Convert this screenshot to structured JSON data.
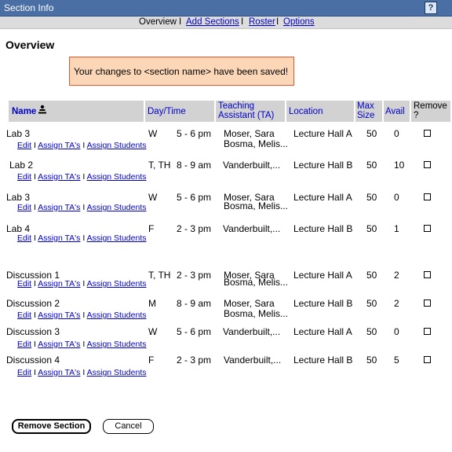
{
  "window": {
    "title": "Section Info",
    "help_icon": "help-icon"
  },
  "subnav": {
    "current": "Overview",
    "links": [
      "Add Sections",
      "Roster",
      "Options"
    ],
    "separator": "I"
  },
  "page": {
    "heading": "Overview"
  },
  "notice": {
    "text": "Your changes to <section name> have been saved!"
  },
  "table": {
    "headers": {
      "name": "Name",
      "sort_icon": "sort-ascending-icon",
      "daytime": "Day/Time",
      "ta_line1": "Teaching",
      "ta_line2": "Assistant (TA)",
      "location": "Location",
      "max_line1": "Max",
      "max_line2": "Size",
      "avail": "Avail",
      "remove_line1": "Remove",
      "remove_line2": "?"
    },
    "row_links": {
      "edit": "Edit",
      "assign_tas": "Assign TA's",
      "assign_students": "Assign Students",
      "separator": "I"
    },
    "rows": [
      {
        "name": "Lab 3",
        "day": "W",
        "time": "5 - 6 pm",
        "ta1": "Moser, Sara",
        "ta2": "Bosma, Melis...",
        "location": "Lecture Hall A",
        "max": "50",
        "avail": "0"
      },
      {
        "name": "Lab 2",
        "day": "T, TH",
        "time": "8 - 9 am",
        "ta1": "Vanderbuilt,...",
        "ta2": "",
        "location": "Lecture Hall B",
        "max": "50",
        "avail": "10"
      },
      {
        "name": "Lab 3",
        "day": "W",
        "time": "5 - 6 pm",
        "ta1": "Moser, Sara",
        "ta2": "Bosma, Melis...",
        "location": "Lecture Hall A",
        "max": "50",
        "avail": "0"
      },
      {
        "name": "Lab 4",
        "day": "F",
        "time": "2 - 3 pm",
        "ta1": "Vanderbuilt,...",
        "ta2": "",
        "location": "Lecture Hall B",
        "max": "50",
        "avail": "1"
      },
      {
        "name": "Discussion 1",
        "day": "T, TH",
        "time": "2 - 3 pm",
        "ta1": "Moser, Sara",
        "ta2": "Bosma, Melis...",
        "location": "Lecture Hall A",
        "max": "50",
        "avail": "2"
      },
      {
        "name": "Discussion 2",
        "day": "M",
        "time": "8 - 9 am",
        "ta1": "Moser, Sara",
        "ta2": "Bosma, Melis...",
        "location": "Lecture Hall B",
        "max": "50",
        "avail": "2"
      },
      {
        "name": "Discussion 3",
        "day": "W",
        "time": "5 - 6 pm",
        "ta1": "Vanderbuilt,...",
        "ta2": "",
        "location": "Lecture Hall A",
        "max": "50",
        "avail": "0"
      },
      {
        "name": "Discussion 4",
        "day": "F",
        "time": "2 - 3 pm",
        "ta1": "Vanderbuilt,...",
        "ta2": "",
        "location": "Lecture Hall B",
        "max": "50",
        "avail": "5"
      }
    ]
  },
  "buttons": {
    "remove": "Remove Section",
    "cancel": "Cancel"
  }
}
